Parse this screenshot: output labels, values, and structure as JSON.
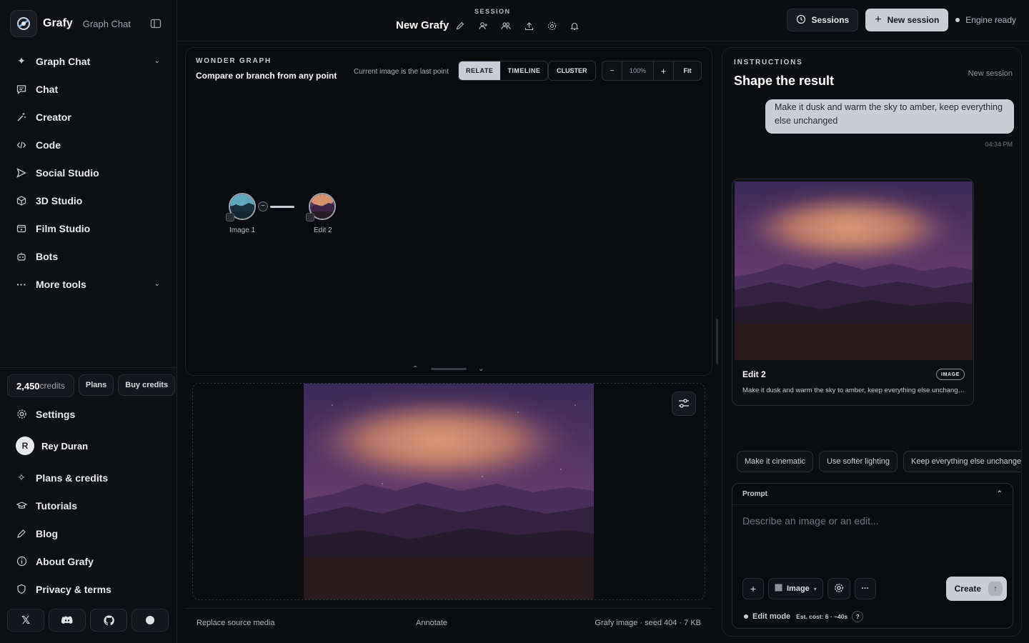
{
  "brand": {
    "name": "Grafy",
    "subtitle": "Graph Chat"
  },
  "nav": [
    {
      "label": "Graph Chat",
      "icon": "sparkle-icon",
      "has_chevron": true
    },
    {
      "label": "Chat",
      "icon": "message-icon"
    },
    {
      "label": "Creator",
      "icon": "wand-icon"
    },
    {
      "label": "Code",
      "icon": "code-icon"
    },
    {
      "label": "Social Studio",
      "icon": "send-icon"
    },
    {
      "label": "3D Studio",
      "icon": "cube-icon"
    },
    {
      "label": "Film Studio",
      "icon": "film-icon"
    },
    {
      "label": "Bots",
      "icon": "bot-icon"
    },
    {
      "label": "More tools",
      "icon": "more-icon",
      "has_chevron": true
    }
  ],
  "credits": {
    "amount": "2,450",
    "unit": "credits",
    "plans_label": "Plans",
    "buy_label": "Buy credits"
  },
  "settings_label": "Settings",
  "user": {
    "initial": "R",
    "name": "Rey Duran"
  },
  "footer_nav": [
    "Plans & credits",
    "Tutorials",
    "Blog",
    "About Grafy",
    "Privacy & terms"
  ],
  "topbar": {
    "session_label": "SESSION",
    "session_title": "New Grafy",
    "sessions_label": "Sessions",
    "new_session_label": "New session",
    "engine_status": "Engine ready"
  },
  "graph": {
    "label": "WONDER GRAPH",
    "title": "Compare or branch from any point",
    "hint": "Current image is the last point",
    "modes": [
      "RELATE",
      "TIMELINE"
    ],
    "active_mode": "RELATE",
    "cluster_label": "CLUSTER",
    "zoom_minus": "−",
    "zoom_value": "100%",
    "zoom_plus": "+",
    "fit_label": "Fit",
    "nodes": [
      {
        "label": "Image 1"
      },
      {
        "label": "Edit 2"
      }
    ]
  },
  "preview_footer": {
    "replace": "Replace source media",
    "annotate": "Annotate",
    "meta": "Grafy image · seed 404 · 7 KB"
  },
  "instructions": {
    "label": "INSTRUCTIONS",
    "title": "Shape the result",
    "session_tag": "New session",
    "user_message": "Make it dusk and warm the sky to amber, keep everything else unchanged",
    "message_time": "04:34 PM",
    "card_title": "Edit 2",
    "card_tag": "IMAGE",
    "card_desc": "Make it dusk and warm the sky to amber, keep everything else unchanged",
    "chips": [
      "Make it cinematic",
      "Use softer lighting",
      "Keep everything else unchanged"
    ]
  },
  "prompt": {
    "label": "Prompt",
    "placeholder": "Describe an image or an edit...",
    "type_label": "Image",
    "create_label": "Create",
    "mode_label": "Edit mode",
    "estimate": "Est. cost: 6 · ~40s",
    "help": "?"
  },
  "colors": {
    "accent": "#c9cdd4",
    "bg": "#0c0d10",
    "sky_warm": "#d69170",
    "dusk_purple": "#5b3a6a"
  }
}
